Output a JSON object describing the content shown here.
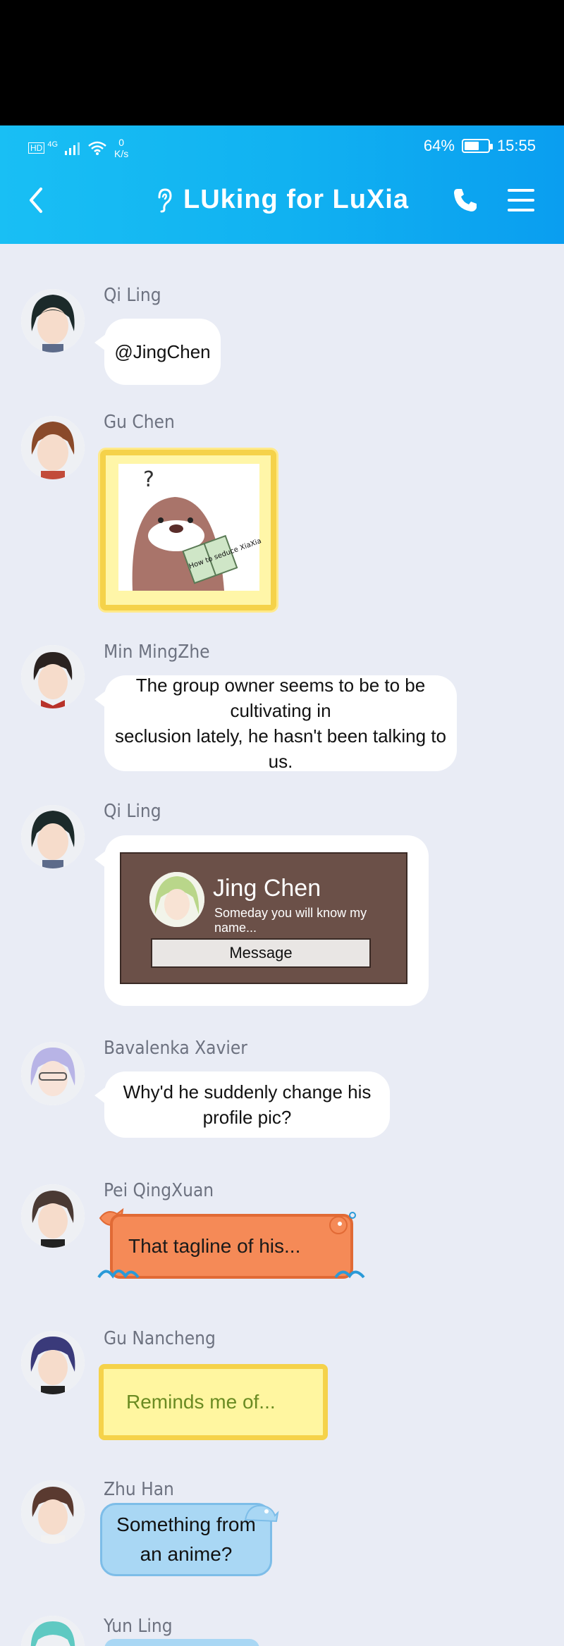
{
  "status_bar": {
    "net_speed_value": "0",
    "net_speed_unit": "K/s",
    "signal_label": "4G",
    "battery_percent": "64%",
    "battery_level": 0.64,
    "time": "15:55"
  },
  "header": {
    "title": "LUking for LuXia",
    "icons": {
      "back": "chevron-left-icon",
      "ear": "ear-icon",
      "phone": "phone-icon",
      "menu": "hamburger-menu-icon"
    }
  },
  "messages": [
    {
      "sender": "Qi Ling",
      "text": "@JingChen"
    },
    {
      "sender": "Gu Chen",
      "sticker_text": "How to seduce XiaXia"
    },
    {
      "sender": "Min MingZhe",
      "line1": "The group owner seems to be to be cultivating in",
      "line2": "seclusion lately, he hasn't been talking to us."
    },
    {
      "sender": "Qi Ling",
      "card": {
        "name": "Jing Chen",
        "tagline": "Someday you will know my name...",
        "button": "Message"
      }
    },
    {
      "sender": "Bavalenka Xavier",
      "text": "Why'd he suddenly change his profile pic?"
    },
    {
      "sender": "Pei QingXuan",
      "text": "That tagline of his..."
    },
    {
      "sender": "Gu Nancheng",
      "text": "Reminds me of..."
    },
    {
      "sender": "Zhu Han",
      "line1": "Something from",
      "line2": "an anime?"
    },
    {
      "sender": "Yun Ling"
    }
  ],
  "colors": {
    "header_start": "#19bff4",
    "header_end": "#0a9ef0",
    "chat_background": "#e9ecf5",
    "orange_bubble": "#f58a57",
    "yellow_bubble": "#fff6a0",
    "blue_bubble": "#a9d7f4",
    "card_background": "#6b5048"
  }
}
